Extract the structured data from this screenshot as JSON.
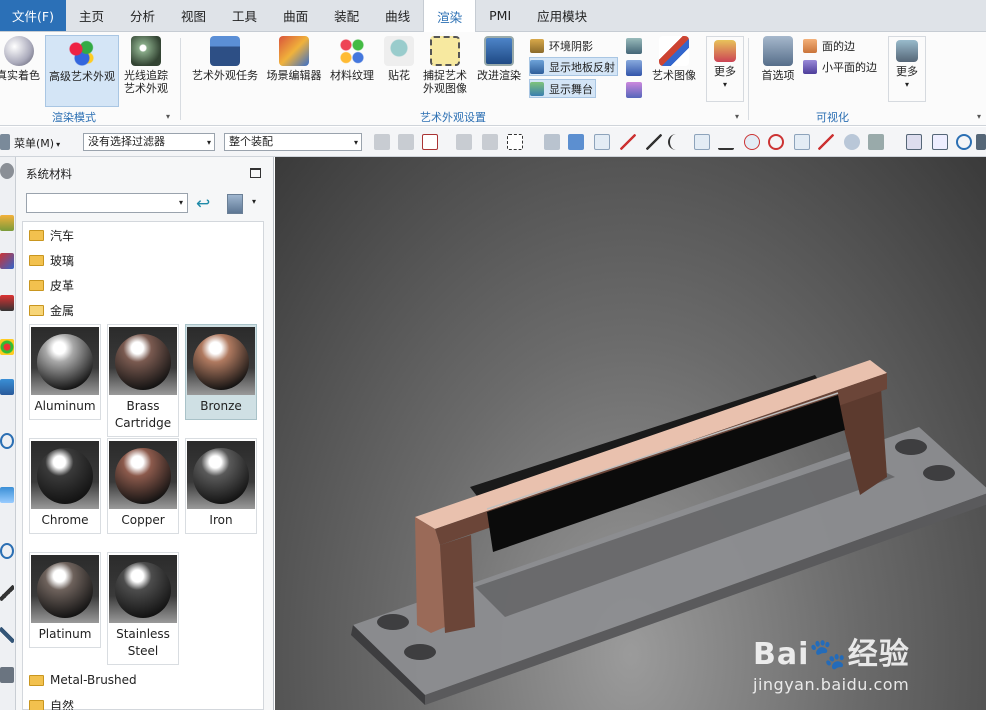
{
  "tabs": {
    "file": "文件(F)",
    "items": [
      "主页",
      "分析",
      "视图",
      "工具",
      "曲面",
      "装配",
      "曲线",
      "渲染",
      "PMI",
      "应用模块"
    ],
    "active": "渲染"
  },
  "ribbon": {
    "render_mode": {
      "label": "渲染模式",
      "true_shading": "真实着色",
      "advanced_studio": "高级艺术外观",
      "raytrace": "光线追踪\n艺术外观"
    },
    "studio_settings": {
      "label": "艺术外观设置",
      "studio_task": "艺术外观任务",
      "scene_editor": "场景编辑器",
      "material_texture": "材料纹理",
      "decal": "贴花",
      "capture": "捕捉艺术\n外观图像",
      "improve_render": "改进渲染",
      "ambient_shadow": "环境阴影",
      "floor_reflection": "显示地板反射",
      "show_stage": "显示舞台",
      "art_image": "艺术图像",
      "more": "更多"
    },
    "visualization": {
      "label": "可视化",
      "preferences": "首选项",
      "face_edges": "面的边",
      "small_face_edges": "小平面的边",
      "more": "更多"
    }
  },
  "selection_bar": {
    "menu": "菜单(M)",
    "filter": "没有选择过滤器",
    "scope": "整个装配"
  },
  "panel": {
    "title": "系统材料",
    "combo_value": "",
    "folders_top": [
      "汽车",
      "玻璃",
      "皮革",
      "金属"
    ],
    "materials": [
      {
        "name": "Aluminum",
        "color": "#a8a8a8",
        "selected": false
      },
      {
        "name": "Brass\nCartridge",
        "color": "#7a5a50",
        "selected": false
      },
      {
        "name": "Bronze",
        "color": "#b07a60",
        "selected": true
      },
      {
        "name": "Chrome",
        "color": "#3a3a3a",
        "selected": false
      },
      {
        "name": "Copper",
        "color": "#8c5a4c",
        "selected": false
      },
      {
        "name": "Iron",
        "color": "#5a5a5a",
        "selected": false
      },
      {
        "name": "Platinum",
        "color": "#6e625c",
        "selected": false
      },
      {
        "name": "Stainless\nSteel",
        "color": "#4d4d4d",
        "selected": false
      }
    ],
    "folders_bottom": [
      "Metal-Brushed",
      "自然"
    ]
  },
  "watermark": {
    "logo": "Bai🐾经验",
    "url": "jingyan.baidu.com"
  }
}
